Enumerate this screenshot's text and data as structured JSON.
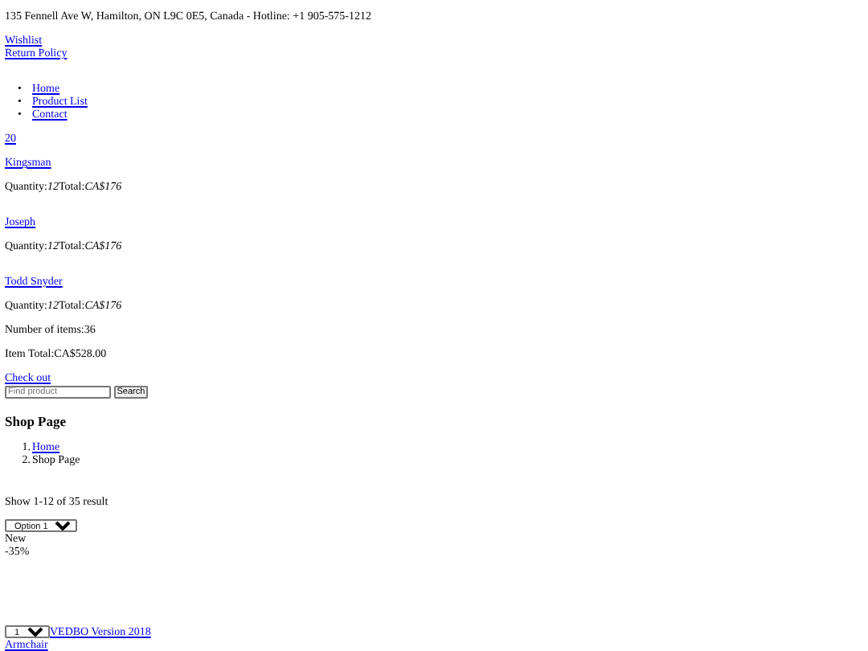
{
  "top_bar": {
    "address": "135 Fennell Ave W, Hamilton, ON L9C 0E5, Canada - Hotline: +1 905-575-1212"
  },
  "links": [
    "Wishlist",
    "Return Policy"
  ],
  "menu": [
    {
      "marker": "•",
      "label": "Home"
    },
    {
      "marker": "•",
      "label": "Product List"
    },
    {
      "marker": "•",
      "label": "Contact"
    }
  ],
  "cart": {
    "count": "20",
    "items": [
      {
        "name": "Kingsman",
        "quantity_label": "Quantity:",
        "quantity": "12",
        "total_label": "Total:",
        "total": "CA$176"
      },
      {
        "name": "Joseph",
        "quantity_label": "Quantity:",
        "quantity": "12",
        "total_label": "Total:",
        "total": "CA$176"
      },
      {
        "name": "Todd Snyder",
        "quantity_label": "Quantity:",
        "quantity": "12",
        "total_label": "Total:",
        "total": "CA$176"
      }
    ],
    "number_of_items": "Number of items:36",
    "item_total": "Item Total:CA$528.00",
    "checkout": "Check out"
  },
  "search": {
    "placeholder": "Find product",
    "button": "Search"
  },
  "page_title": "Shop Page",
  "breadcrumb": [
    {
      "number": "1.",
      "label": "Home",
      "link": true
    },
    {
      "number": "2.",
      "label": "Shop Page",
      "link": false
    }
  ],
  "result_count": "Show 1-12 of 35 result",
  "sort_select": "Option 1",
  "product": {
    "badges": [
      "New",
      "-35%"
    ],
    "quantity_select": "1",
    "title": "VEDBO Version 2018",
    "subtitle": "Armchair"
  }
}
